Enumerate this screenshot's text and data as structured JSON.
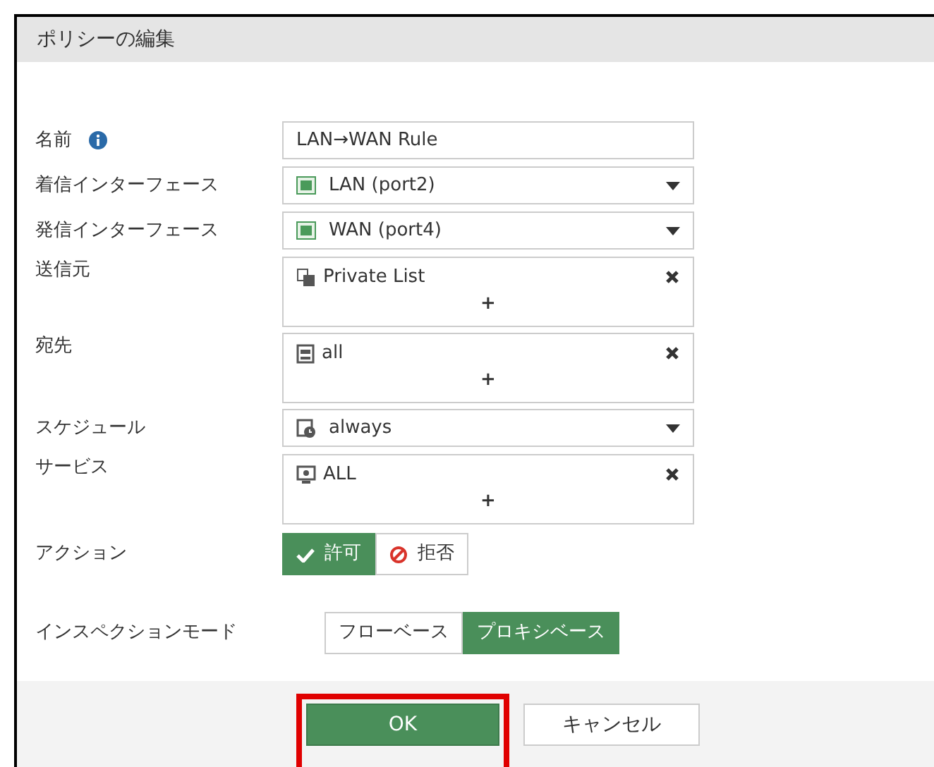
{
  "dialog": {
    "title": "ポリシーの編集"
  },
  "fields": [
    {
      "kind": "text",
      "label": "名前",
      "info": true,
      "value": "LAN→WAN Rule"
    },
    {
      "kind": "interface",
      "label": "着信インターフェース",
      "value": "LAN (port2)"
    },
    {
      "kind": "interface",
      "label": "発信インターフェース",
      "value": "WAN (port4)"
    },
    {
      "kind": "address-group",
      "label": "送信元",
      "value": "Private List",
      "add": "+"
    },
    {
      "kind": "address",
      "label": "宛先",
      "value": "all",
      "add": "+"
    },
    {
      "kind": "schedule",
      "label": "スケジュール",
      "value": "always"
    },
    {
      "kind": "service",
      "label": "サービス",
      "value": "ALL",
      "add": "+"
    },
    {
      "kind": "toggle",
      "label": "アクション",
      "options": [
        {
          "label": "許可",
          "kind": "allow",
          "selected": true
        },
        {
          "label": "拒否",
          "kind": "deny",
          "selected": false
        }
      ]
    },
    {
      "kind": "toggle",
      "label": "インスペクションモード",
      "options": [
        {
          "label": "フローベース",
          "selected": false
        },
        {
          "label": "プロキシベース",
          "selected": true
        }
      ]
    }
  ],
  "buttons": [
    {
      "label": "OK",
      "kind": "primary",
      "highlighted": true
    },
    {
      "label": "キャンセル",
      "kind": "secondary",
      "highlighted": false
    }
  ]
}
